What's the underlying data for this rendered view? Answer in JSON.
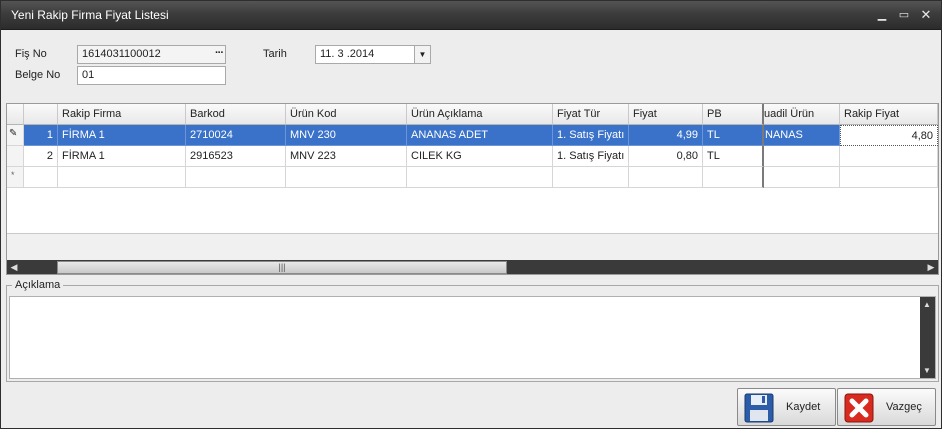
{
  "window": {
    "title": "Yeni Rakip Firma Fiyat Listesi"
  },
  "form": {
    "fis_no_label": "Fiş No",
    "fis_no_value": "1614031100012",
    "fis_no_button": "···",
    "belge_no_label": "Belge No",
    "belge_no_value": "01",
    "tarih_label": "Tarih",
    "tarih_value": "11. 3 .2014"
  },
  "grid": {
    "columns": [
      "Rakip Firma",
      "Barkod",
      "Ürün Kod",
      "Ürün Açıklama",
      "Fiyat Tür",
      "Fiyat",
      "PB",
      "uadil Ürün",
      "Rakip Fiyat"
    ],
    "rows": [
      {
        "no": "1",
        "cells": [
          "FİRMA 1",
          "2710024",
          "MNV 230",
          "ANANAS ADET",
          "1. Satış Fiyatı",
          "4,99",
          "TL",
          "NANAS",
          "4,80"
        ]
      },
      {
        "no": "2",
        "cells": [
          "FİRMA 1",
          "2916523",
          "MNV 223",
          "CILEK  KG",
          "1. Satış Fiyatı",
          "0,80",
          "TL",
          "",
          ""
        ]
      }
    ],
    "new_row_marker": "*",
    "edit_marker": "✎"
  },
  "aciklama": {
    "label": "Açıklama",
    "value": ""
  },
  "buttons": {
    "save": "Kaydet",
    "cancel": "Vazgeç"
  }
}
